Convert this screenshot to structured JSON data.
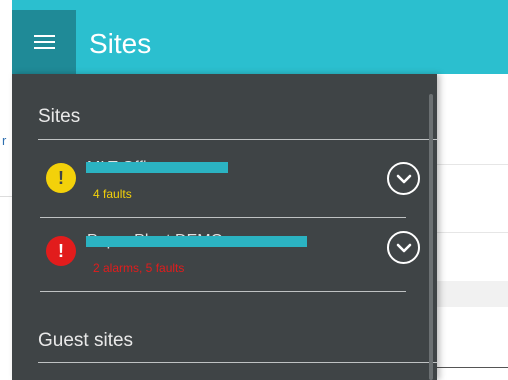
{
  "app": {
    "title": "Sites"
  },
  "drawer": {
    "sections": [
      {
        "header": "Sites"
      },
      {
        "header": "Guest sites"
      }
    ],
    "sites": [
      {
        "name": "MLT Office",
        "status_text": "4 faults",
        "status": "warning",
        "status_color": "#f3d10a"
      },
      {
        "name": "Paper Plant DEMO",
        "status_text": "2 alarms, 5 faults",
        "status": "alarm",
        "status_color": "#e21c1c"
      }
    ],
    "icons": {
      "warning": "!",
      "alarm": "!",
      "expand": "chevron-down-icon",
      "menu": "hamburger-icon"
    }
  },
  "colors": {
    "appbar": "#2bbfcf",
    "menu_button": "#1f8a97",
    "drawer": "#3f4446",
    "redaction": "#2bb3c2"
  }
}
